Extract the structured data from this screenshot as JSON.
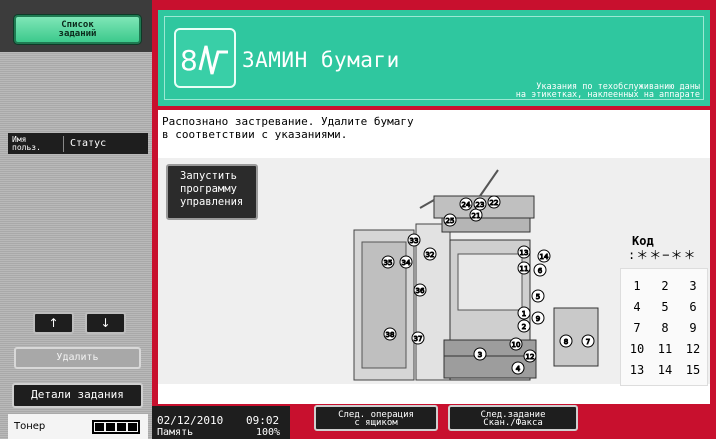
{
  "sidebar": {
    "jobs_button": [
      "Список",
      "заданий"
    ],
    "col_user": [
      "Имя",
      "польз."
    ],
    "col_status": "Статус",
    "up_arrow": "↑",
    "down_arrow": "↓",
    "delete_button": "Удалить",
    "details_button": "Детали задания",
    "toner_label": "Тонер"
  },
  "header": {
    "title": "ЗАМИН бумаги",
    "service_note": [
      "Указания по техобслуживанию даны",
      "на этикетках, наклеенных на аппарате"
    ]
  },
  "content": {
    "instruction": [
      "Распознано застревание. Удалите бумагу",
      "в соответствии с указаниями."
    ],
    "guide_button": [
      "Запустить",
      "программу",
      "управления"
    ],
    "code_label": "Код",
    "code_value": ":＊＊−＊＊",
    "keypad": [
      "1",
      "2",
      "3",
      "4",
      "5",
      "6",
      "7",
      "8",
      "9",
      "10",
      "11",
      "12",
      "13",
      "14",
      "15"
    ],
    "jam_markers": [
      "1",
      "2",
      "3",
      "4",
      "5",
      "6",
      "7",
      "8",
      "9",
      "10",
      "11",
      "12",
      "13",
      "14",
      "21",
      "22",
      "23",
      "24",
      "25",
      "32",
      "33",
      "34",
      "35",
      "36",
      "37",
      "38"
    ]
  },
  "footer": {
    "date": "02/12/2010",
    "time": "09:02",
    "memory_label": "Память",
    "memory_value": "100%",
    "next_operation": [
      "След. операция",
      "с ящиком"
    ],
    "next_job": [
      "След.задание",
      "Скан./Факса"
    ]
  },
  "colors": {
    "accent_green": "#2fc79f",
    "frame_red": "#c8102e",
    "button_dark": "#1e1e1e"
  }
}
